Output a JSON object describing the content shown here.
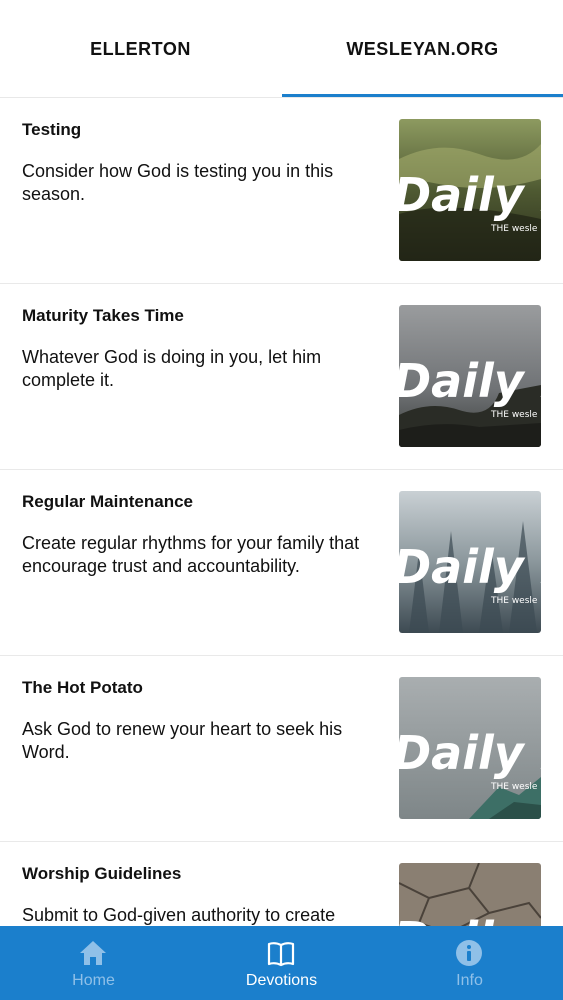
{
  "tabs": [
    {
      "label": "ELLERTON",
      "active": false
    },
    {
      "label": "WESLEYAN.ORG",
      "active": true
    }
  ],
  "thumbnail_brand": {
    "script": "Daily D",
    "publisher": "THE wesle"
  },
  "devotions": [
    {
      "title": "Testing",
      "description": "Consider how God is testing you in this season."
    },
    {
      "title": "Maturity Takes Time",
      "description": "Whatever God is doing in you, let him complete it."
    },
    {
      "title": "Regular Maintenance",
      "description": "Create regular rhythms for your family that encourage trust and accountability."
    },
    {
      "title": "The Hot Potato",
      "description": "Ask God to renew your heart to seek his Word."
    },
    {
      "title": "Worship Guidelines",
      "description": "Submit to God-given authority to create"
    }
  ],
  "bottom_nav": [
    {
      "label": "Home",
      "icon": "home-icon",
      "active": false
    },
    {
      "label": "Devotions",
      "icon": "book-icon",
      "active": true
    },
    {
      "label": "Info",
      "icon": "info-icon",
      "active": false
    }
  ],
  "colors": {
    "accent": "#1b7fcc",
    "inactive_nav": "#8fc0e8",
    "active_nav": "#ffffff"
  }
}
